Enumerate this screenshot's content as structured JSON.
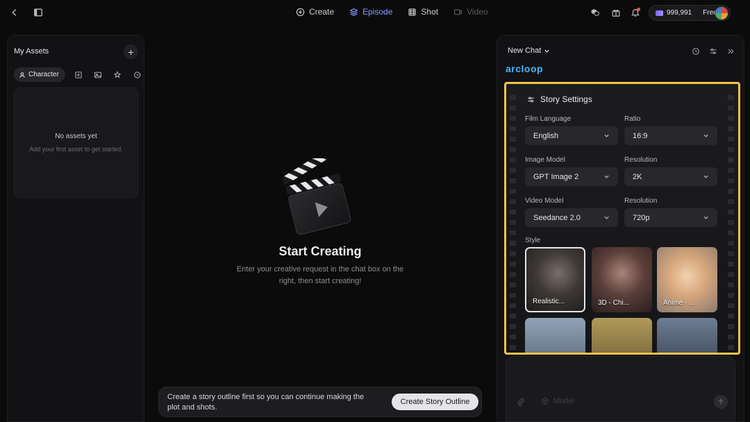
{
  "topbar": {
    "nav": [
      {
        "label": "Create",
        "state": "normal"
      },
      {
        "label": "Episode",
        "state": "active"
      },
      {
        "label": "Shot",
        "state": "normal"
      },
      {
        "label": "Video",
        "state": "disabled"
      }
    ],
    "credits": {
      "amount": "999,991",
      "plan": "Free"
    }
  },
  "left_panel": {
    "title": "My Assets",
    "active_tab": "Character",
    "empty_title": "No assets yet",
    "empty_subtitle": "Add your first asset to get started."
  },
  "center": {
    "title": "Start Creating",
    "subtitle": "Enter your creative request in the chat box on the right, then start creating!"
  },
  "bottom_bar": {
    "text": "Create a story outline first so you can continue making the plot and shots.",
    "button": "Create Story Outline"
  },
  "right_panel": {
    "title": "New Chat",
    "logo": "arcloop",
    "settings": {
      "heading": "Story Settings",
      "film_language_label": "Film Language",
      "film_language": "English",
      "ratio_label": "Ratio",
      "ratio": "16:9",
      "image_model_label": "Image Model",
      "image_model": "GPT Image 2",
      "image_resolution_label": "Resolution",
      "image_resolution": "2K",
      "video_model_label": "Video Model",
      "video_model": "Seedance 2.0",
      "video_resolution_label": "Resolution",
      "video_resolution": "720p",
      "style_label": "Style",
      "styles": [
        "Realistic...",
        "3D - Chi...",
        "Anime - ..."
      ]
    },
    "chat_input": {
      "model_placeholder": "Model"
    }
  },
  "colors": {
    "accent": "#8b95ff",
    "highlight": "#f3c24a",
    "logo": "#4bb5ff"
  }
}
